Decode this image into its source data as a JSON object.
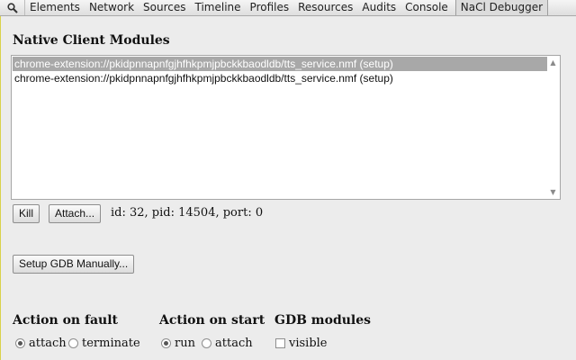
{
  "toolbar": {
    "search_icon": "search-icon",
    "tabs": [
      "Elements",
      "Network",
      "Sources",
      "Timeline",
      "Profiles",
      "Resources",
      "Audits",
      "Console",
      "NaCl Debugger"
    ],
    "active_tab": "NaCl Debugger"
  },
  "modules": {
    "heading": "Native Client Modules",
    "items": [
      {
        "label": "chrome-extension://pkidpnnapnfgjhfhkpmjpbckkbaodldb/tts_service.nmf (setup)",
        "selected": true
      },
      {
        "label": "chrome-extension://pkidpnnapnfgjhfhkpmjpbckkbaodldb/tts_service.nmf (setup)",
        "selected": false
      }
    ]
  },
  "actions": {
    "kill_label": "Kill",
    "attach_label": "Attach...",
    "info": "id: 32, pid: 14504, port: 0",
    "setup_gdb_label": "Setup GDB Manually..."
  },
  "fault": {
    "title": "Action on fault",
    "options": [
      "attach",
      "terminate"
    ],
    "selected": "attach"
  },
  "start": {
    "title": "Action on start",
    "options": [
      "run",
      "attach"
    ],
    "selected": "run"
  },
  "gdb_modules": {
    "title": "GDB modules",
    "visible_label": "visible",
    "visible_checked": false
  }
}
